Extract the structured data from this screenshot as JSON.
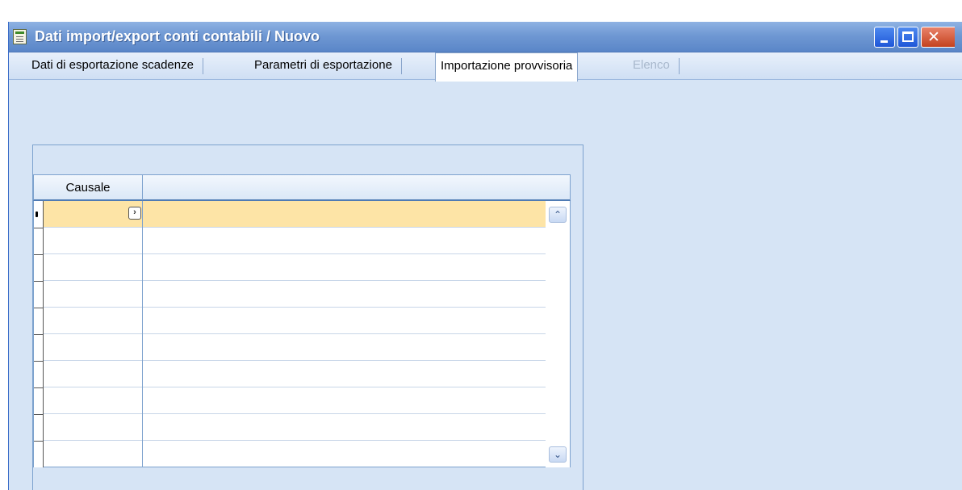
{
  "window": {
    "title": "Dati import/export conti contabili / Nuovo",
    "icon": "form-document-icon",
    "controls": {
      "minimize": "minimize-icon",
      "maximize": "maximize-icon",
      "close": "close-icon"
    }
  },
  "tabs": [
    {
      "label": "Dati di esportazione scadenze",
      "state": "normal"
    },
    {
      "label": "Parametri di esportazione",
      "state": "normal"
    },
    {
      "label": "Importazione provvisoria",
      "state": "active"
    },
    {
      "label": "Elenco",
      "state": "disabled"
    }
  ],
  "grid": {
    "columns": [
      {
        "header": "Causale"
      },
      {
        "header": ""
      }
    ],
    "rows": [
      {
        "causale": "",
        "value": "",
        "selected": true
      },
      {
        "causale": "",
        "value": "",
        "selected": false
      },
      {
        "causale": "",
        "value": "",
        "selected": false
      },
      {
        "causale": "",
        "value": "",
        "selected": false
      },
      {
        "causale": "",
        "value": "",
        "selected": false
      },
      {
        "causale": "",
        "value": "",
        "selected": false
      },
      {
        "causale": "",
        "value": "",
        "selected": false
      },
      {
        "causale": "",
        "value": "",
        "selected": false
      },
      {
        "causale": "",
        "value": "",
        "selected": false
      },
      {
        "causale": "",
        "value": "",
        "selected": false
      }
    ],
    "zoom_button": "›",
    "scroll_up": "⌃",
    "scroll_down": "⌄"
  },
  "colors": {
    "selected_row": "#fde4a6",
    "titlebar": "#6f98d3",
    "background": "#d6e4f5"
  }
}
